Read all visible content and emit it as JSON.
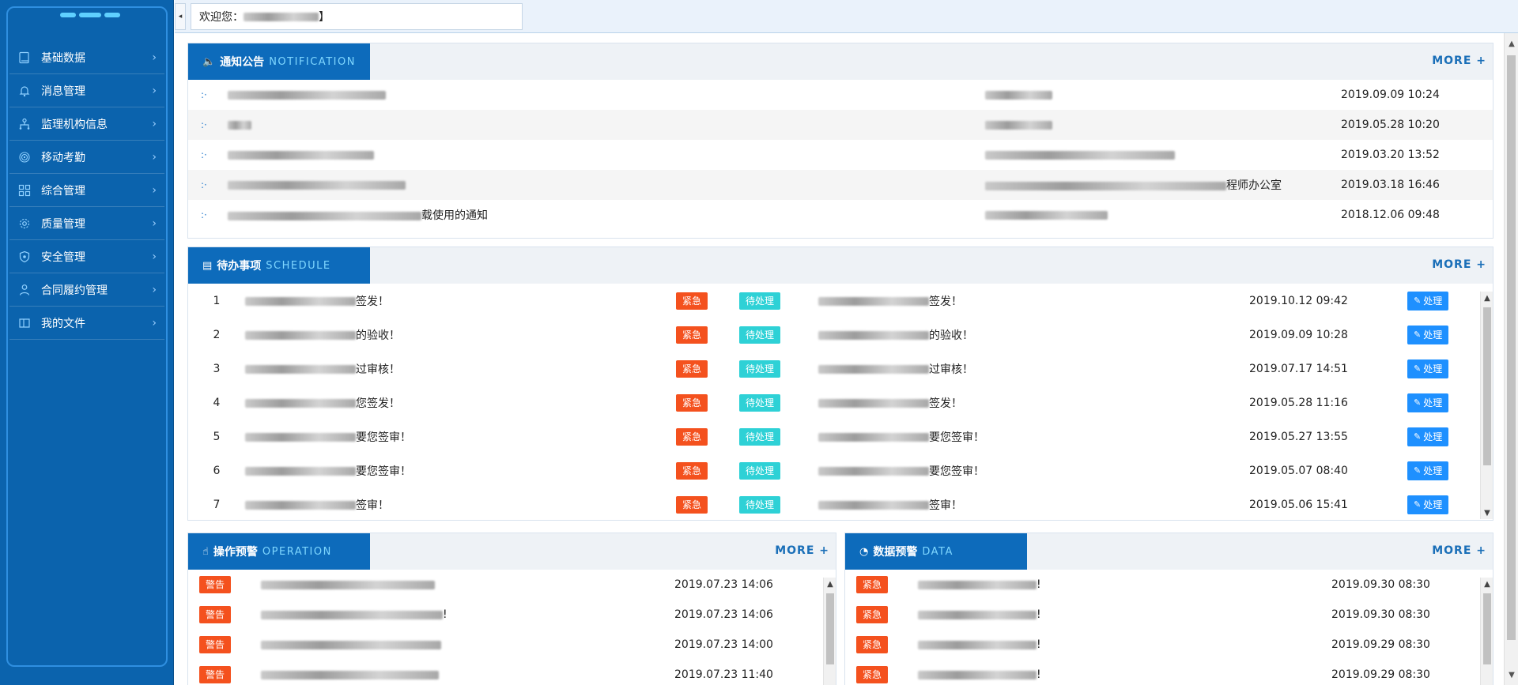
{
  "sidebar": {
    "items": [
      {
        "label": "基础数据",
        "icon": "book-icon"
      },
      {
        "label": "消息管理",
        "icon": "bell-icon"
      },
      {
        "label": "监理机构信息",
        "icon": "org-icon"
      },
      {
        "label": "移动考勤",
        "icon": "fingerprint-icon"
      },
      {
        "label": "综合管理",
        "icon": "grid-icon"
      },
      {
        "label": "质量管理",
        "icon": "gear-icon"
      },
      {
        "label": "安全管理",
        "icon": "shield-icon"
      },
      {
        "label": "合同履约管理",
        "icon": "user-icon"
      },
      {
        "label": "我的文件",
        "icon": "folder-icon"
      }
    ]
  },
  "topbar": {
    "welcome_label": "欢迎您：",
    "welcome_suffix": "】"
  },
  "notification": {
    "title": "通知公告",
    "title_en": "NOTIFICATION",
    "more": "MORE +",
    "rows": [
      {
        "title_tail": "",
        "source_tail": "",
        "date": "2019.09.09 10:24"
      },
      {
        "title_tail": "",
        "source_tail": "",
        "date": "2019.05.28 10:20"
      },
      {
        "title_tail": "",
        "source_tail": "",
        "date": "2019.03.20 13:52"
      },
      {
        "title_tail": "",
        "source_tail": "程师办公室",
        "date": "2019.03.18 16:46"
      },
      {
        "title_tail": "载使用的通知",
        "source_tail": "",
        "date": "2018.12.06 09:48"
      }
    ]
  },
  "schedule": {
    "title": "待办事项",
    "title_en": "SCHEDULE",
    "more": "MORE +",
    "urgent": "紧急",
    "pending": "待处理",
    "action": "处理",
    "rows": [
      {
        "no": "1",
        "title_tail": "签发！",
        "desc_tail": "签发！",
        "date": "2019.10.12 09:42"
      },
      {
        "no": "2",
        "title_tail": "的验收！",
        "desc_tail": "的验收！",
        "date": "2019.09.09 10:28"
      },
      {
        "no": "3",
        "title_tail": "过审核！",
        "desc_tail": "过审核！",
        "date": "2019.07.17 14:51"
      },
      {
        "no": "4",
        "title_tail": "您签发！",
        "desc_tail": "签发！",
        "date": "2019.05.28 11:16"
      },
      {
        "no": "5",
        "title_tail": "要您签审！",
        "desc_tail": "要您签审！",
        "date": "2019.05.27 13:55"
      },
      {
        "no": "6",
        "title_tail": "要您签审！",
        "desc_tail": "要您签审！",
        "date": "2019.05.07 08:40"
      },
      {
        "no": "7",
        "title_tail": "签审！",
        "desc_tail": "签审！",
        "date": "2019.05.06 15:41"
      }
    ]
  },
  "operation": {
    "title": "操作预警",
    "title_en": "OPERATION",
    "more": "MORE +",
    "rows": [
      {
        "badge": "警告",
        "tail": "",
        "date": "2019.07.23 14:06"
      },
      {
        "badge": "警告",
        "tail": "!",
        "date": "2019.07.23 14:06"
      },
      {
        "badge": "警告",
        "tail": "",
        "date": "2019.07.23 14:00"
      },
      {
        "badge": "警告",
        "tail": "",
        "date": "2019.07.23 11:40"
      }
    ]
  },
  "data_warning": {
    "title": "数据预警",
    "title_en": "DATA",
    "more": "MORE +",
    "rows": [
      {
        "badge": "紧急",
        "tail": "!",
        "date": "2019.09.30 08:30"
      },
      {
        "badge": "紧急",
        "tail": "!",
        "date": "2019.09.30 08:30"
      },
      {
        "badge": "紧急",
        "tail": "!",
        "date": "2019.09.29 08:30"
      },
      {
        "badge": "紧急",
        "tail": "!",
        "date": "2019.09.29 08:30"
      }
    ]
  }
}
